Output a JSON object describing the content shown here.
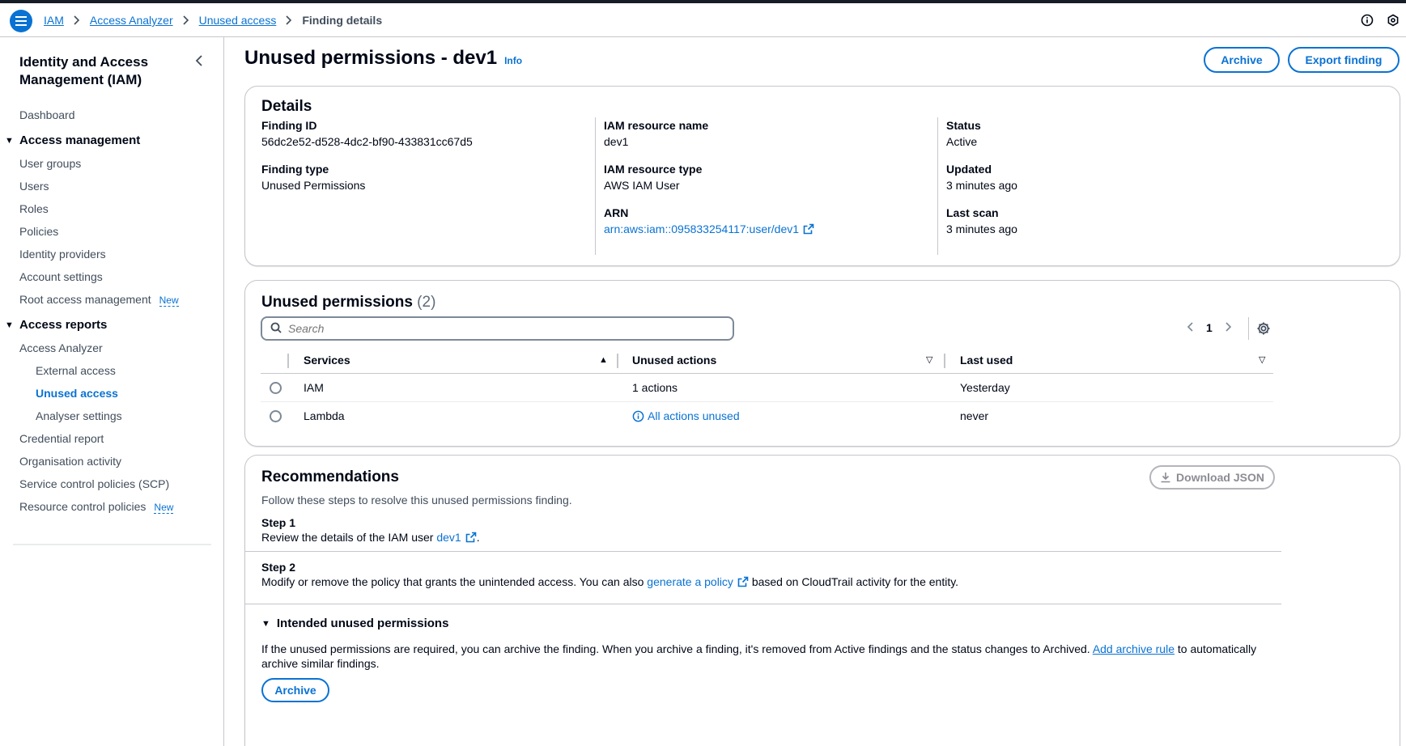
{
  "breadcrumb": {
    "items": [
      "IAM",
      "Access Analyzer",
      "Unused access"
    ],
    "current": "Finding details"
  },
  "sidebar": {
    "title": "Identity and Access Management (IAM)",
    "dashboard": "Dashboard",
    "sections": [
      {
        "label": "Access management",
        "items": [
          "User groups",
          "Users",
          "Roles",
          "Policies",
          "Identity providers",
          "Account settings",
          "Root access management"
        ]
      },
      {
        "label": "Access reports",
        "items": [
          "Access Analyzer",
          "External access",
          "Unused access",
          "Analyser settings",
          "Credential report",
          "Organisation activity",
          "Service control policies (SCP)",
          "Resource control policies"
        ]
      }
    ],
    "new_badge": "New",
    "active_item": "Unused access"
  },
  "page": {
    "title": "Unused permissions - dev1",
    "info": "Info",
    "archive_label": "Archive",
    "export_label": "Export finding"
  },
  "details": {
    "heading": "Details",
    "finding_id_label": "Finding ID",
    "finding_id": "56dc2e52-d528-4dc2-bf90-433831cc67d5",
    "finding_type_label": "Finding type",
    "finding_type": "Unused Permissions",
    "resource_name_label": "IAM resource name",
    "resource_name": "dev1",
    "resource_type_label": "IAM resource type",
    "resource_type": "AWS IAM User",
    "arn_label": "ARN",
    "arn": "arn:aws:iam::095833254117:user/dev1",
    "status_label": "Status",
    "status": "Active",
    "updated_label": "Updated",
    "updated": "3 minutes ago",
    "last_scan_label": "Last scan",
    "last_scan": "3 minutes ago"
  },
  "unused_permissions": {
    "title": "Unused permissions",
    "count": "(2)",
    "search_placeholder": "Search",
    "page": "1",
    "columns": [
      "Services",
      "Unused actions",
      "Last used"
    ],
    "rows": [
      {
        "service": "IAM",
        "actions": "1 actions",
        "last_used": "Yesterday"
      },
      {
        "service": "Lambda",
        "actions": "All actions unused",
        "last_used": "never"
      }
    ]
  },
  "recommendations": {
    "title": "Recommendations",
    "download_label": "Download JSON",
    "description": "Follow these steps to resolve this unused permissions finding.",
    "step1_label": "Step 1",
    "step1_text": "Review the details of the IAM user",
    "step1_link": "dev1",
    "step2_label": "Step 2",
    "step2_text_before": "Modify or remove the policy that grants the unintended access. You can also",
    "step2_link": "generate a policy",
    "step2_text_after": "based on CloudTrail activity for the entity.",
    "intended_title": "Intended unused permissions",
    "intended_text_before": "If the unused permissions are required, you can archive the finding. When you archive a finding, it's removed from Active findings and the status changes to Archived.",
    "intended_link": "Add archive rule",
    "intended_text_after": "to automatically archive similar findings.",
    "archive_label": "Archive"
  },
  "colors": {
    "accent": "#0972d3",
    "text": "#000716",
    "border": "#c6c6cd"
  }
}
